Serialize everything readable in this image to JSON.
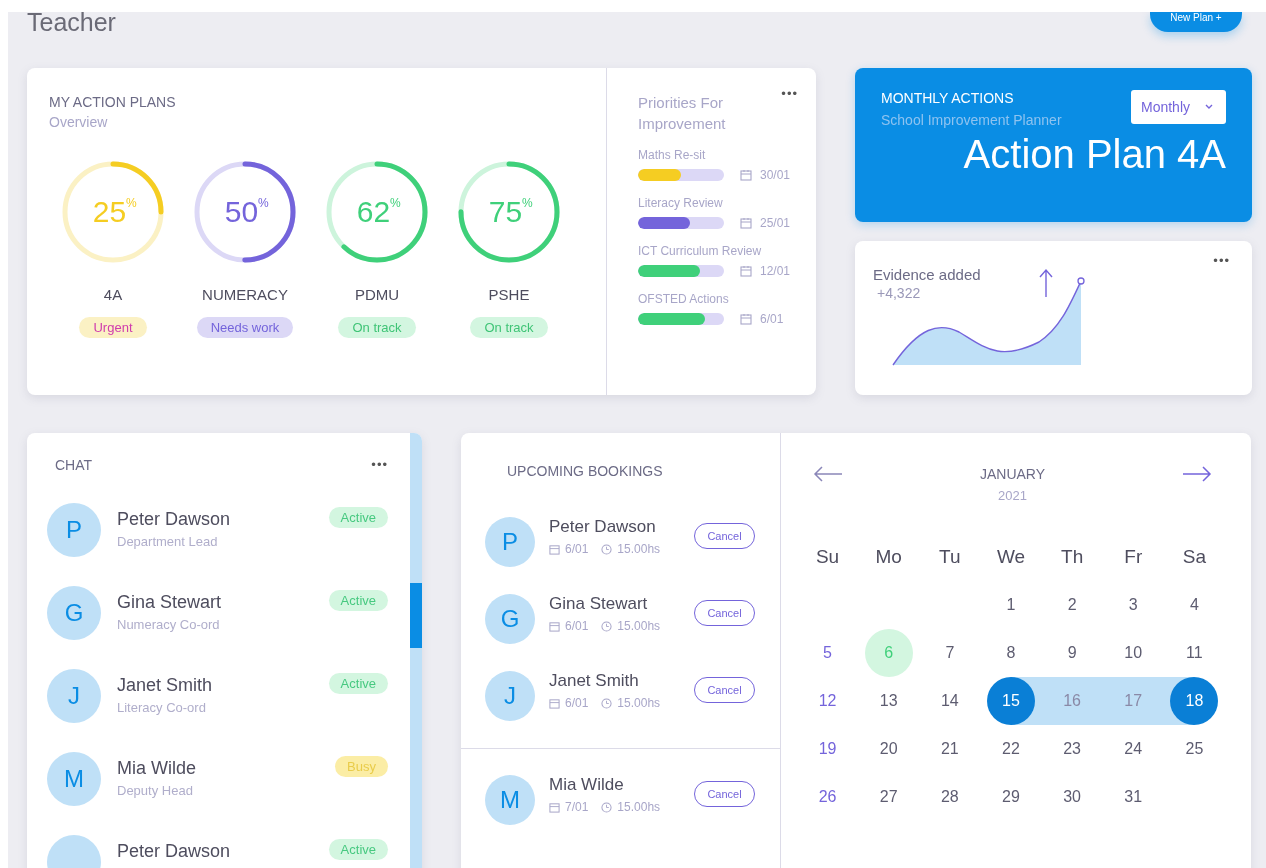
{
  "page_title": "Teacher",
  "new_plan_button": "New Plan +",
  "action_plans": {
    "title": "MY ACTION PLANS",
    "subtitle": "Overview",
    "plans": [
      {
        "percent": "25",
        "unit": "%",
        "label": "4A",
        "status": "Urgent",
        "kind": "urgent"
      },
      {
        "percent": "50",
        "unit": "%",
        "label": "NUMERACY",
        "status": "Needs work",
        "kind": "needs_work"
      },
      {
        "percent": "62",
        "unit": "%",
        "label": "PDMU",
        "status": "On track",
        "kind": "on_track"
      },
      {
        "percent": "75",
        "unit": "%",
        "label": "PSHE",
        "status": "On track",
        "kind": "on_track"
      }
    ]
  },
  "priorities": {
    "title": "Priorities For Improvement",
    "menu": "•••",
    "items": [
      {
        "name": "Maths Re-sit",
        "kind": "urgent",
        "level": 0.5,
        "date": "30/01"
      },
      {
        "name": "Literacy Review",
        "kind": "needs_work",
        "level": 0.6,
        "date": "25/01"
      },
      {
        "name": "ICT Curriculum Review",
        "kind": "on_track",
        "level": 0.72,
        "date": "12/01"
      },
      {
        "name": "OFSTED Actions",
        "kind": "on_track",
        "level": 0.78,
        "date": "6/01"
      }
    ]
  },
  "monthly_actions": {
    "title": "MONTHLY ACTIONS",
    "subtitle": "School Improvement Planner",
    "dropdown": "Monthly",
    "headline": "Action Plan 4A"
  },
  "evidence": {
    "title": "Evidence added",
    "value": "+4,322",
    "menu": "•••"
  },
  "chat": {
    "title": "CHAT",
    "menu": "•••",
    "contacts": [
      {
        "initial": "P",
        "name": "Peter Dawson",
        "role": "Department Lead",
        "status": "Active",
        "kind": "active"
      },
      {
        "initial": "G",
        "name": "Gina Stewart",
        "role": "Numeracy Co-ord",
        "status": "Active",
        "kind": "active"
      },
      {
        "initial": "J",
        "name": "Janet Smith",
        "role": "Literacy Co-ord",
        "status": "Active",
        "kind": "active"
      },
      {
        "initial": "M",
        "name": "Mia Wilde",
        "role": "Deputy Head",
        "status": "Busy",
        "kind": "busy"
      },
      {
        "name": "Peter Dawson",
        "status": "Active",
        "kind": "active"
      }
    ]
  },
  "bookings": {
    "title": "UPCOMING BOOKINGS",
    "items": [
      {
        "initial": "P",
        "name": "Peter Dawson",
        "date": "6/01",
        "time": "15.00hs",
        "action": "Cancel",
        "separated": false
      },
      {
        "initial": "G",
        "name": "Gina Stewart",
        "date": "6/01",
        "time": "15.00hs",
        "action": "Cancel",
        "separated": false
      },
      {
        "initial": "J",
        "name": "Janet Smith",
        "date": "6/01",
        "time": "15.00hs",
        "action": "Cancel",
        "separated": false
      },
      {
        "initial": "M",
        "name": "Mia Wilde",
        "date": "7/01",
        "time": "15.00hs",
        "action": "Cancel",
        "separated": true
      }
    ]
  },
  "calendar": {
    "month": "JANUARY",
    "year": "2021",
    "weekdays": [
      "Su",
      "Mo",
      "Tu",
      "We",
      "Th",
      "Fr",
      "Sa"
    ],
    "days": [
      {
        "n": "1",
        "kind": "plain"
      },
      {
        "n": "2",
        "kind": "plain"
      },
      {
        "n": "3",
        "kind": "plain"
      },
      {
        "n": "4",
        "kind": "plain"
      },
      {
        "n": "5",
        "kind": "sunday"
      },
      {
        "n": "6",
        "kind": "today"
      },
      {
        "n": "7",
        "kind": "plain"
      },
      {
        "n": "8",
        "kind": "plain"
      },
      {
        "n": "9",
        "kind": "plain"
      },
      {
        "n": "10",
        "kind": "plain"
      },
      {
        "n": "11",
        "kind": "plain"
      },
      {
        "n": "12",
        "kind": "sunday"
      },
      {
        "n": "13",
        "kind": "plain"
      },
      {
        "n": "14",
        "kind": "plain"
      },
      {
        "n": "15",
        "kind": "range_start"
      },
      {
        "n": "16",
        "kind": "in_range"
      },
      {
        "n": "17",
        "kind": "in_range"
      },
      {
        "n": "18",
        "kind": "range_end"
      },
      {
        "n": "19",
        "kind": "sunday"
      },
      {
        "n": "20",
        "kind": "plain"
      },
      {
        "n": "21",
        "kind": "plain"
      },
      {
        "n": "22",
        "kind": "plain"
      },
      {
        "n": "23",
        "kind": "plain"
      },
      {
        "n": "24",
        "kind": "plain"
      },
      {
        "n": "25",
        "kind": "plain"
      },
      {
        "n": "26",
        "kind": "sunday"
      },
      {
        "n": "27",
        "kind": "plain"
      },
      {
        "n": "28",
        "kind": "plain"
      },
      {
        "n": "29",
        "kind": "plain"
      },
      {
        "n": "30",
        "kind": "plain"
      },
      {
        "n": "31",
        "kind": "plain"
      }
    ]
  }
}
